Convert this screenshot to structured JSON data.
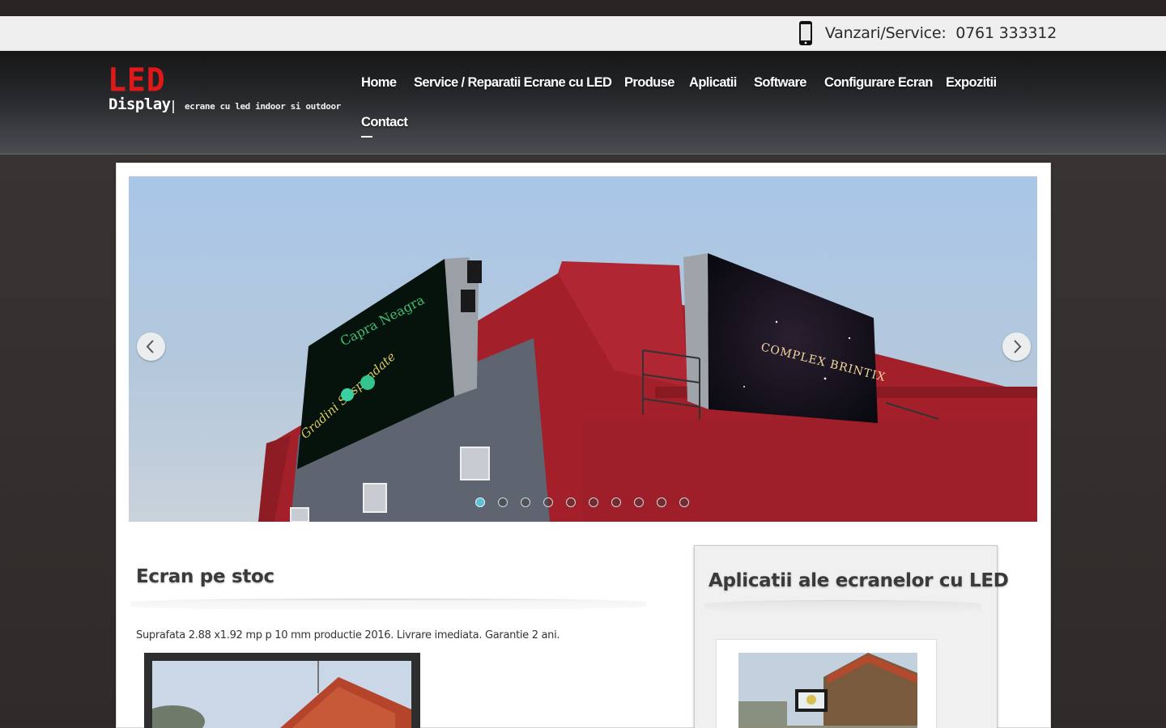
{
  "contact_bar": {
    "phone_text": "Vanzari/Service:  0761 333312",
    "icon": "smartphone-icon"
  },
  "logo": {
    "led": "LED",
    "display": "Display",
    "tagline": "ecrane cu led indoor si outdoor"
  },
  "nav": {
    "items": [
      {
        "label": "Home"
      },
      {
        "label": "Service / Reparatii Ecrane cu LED"
      },
      {
        "label": "Produse"
      },
      {
        "label": "Aplicatii"
      },
      {
        "label": "Software"
      },
      {
        "label": "Configurare Ecran"
      },
      {
        "label": "Expozitii"
      },
      {
        "label": "Contact"
      }
    ],
    "active": "Contact"
  },
  "slider": {
    "slide_count": 10,
    "active_index": 1,
    "left_screen_text": "Capra Neagra",
    "left_screen_script": "Gradini Suspendate",
    "right_screen_text": "COMPLEX BRINTIX",
    "prev_icon": "chevron-left-icon",
    "next_icon": "chevron-right-icon"
  },
  "stock": {
    "title": "Ecran pe stoc",
    "description": "Suprafata 2.88 x1.92 mp p 10 mm productie 2016. Livrare imediata. Garantie 2 ani."
  },
  "sidebar": {
    "title": "Aplicatii ale ecranelor cu LED"
  },
  "colors": {
    "logo_red": "#e01818",
    "dot_active": "#5fbfd6",
    "building_red": "#a3202a"
  }
}
